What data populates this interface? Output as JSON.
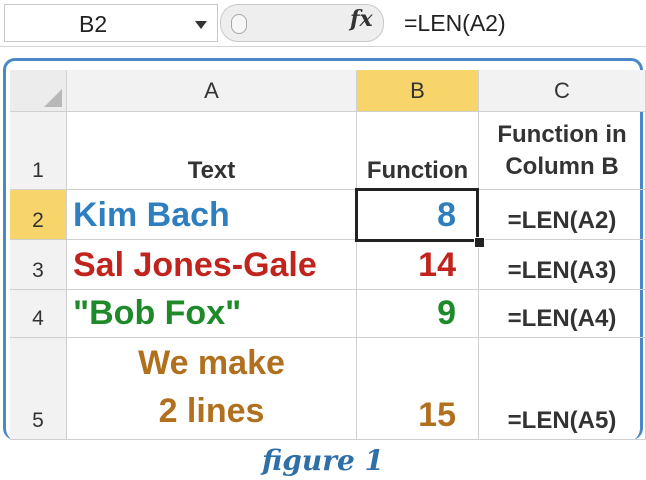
{
  "formula_bar": {
    "name_box": "B2",
    "fx_label": "fx",
    "formula": "=LEN(A2)"
  },
  "columns": [
    {
      "label": "A"
    },
    {
      "label": "B",
      "active": true
    },
    {
      "label": "C"
    }
  ],
  "rows": [
    {
      "num": "1",
      "a": "Text",
      "b": "Function",
      "c1": "Function in",
      "c2": "Column B"
    },
    {
      "num": "2",
      "a": "Kim Bach",
      "b": "8",
      "c": "=LEN(A2)",
      "color": "#2f7fbf"
    },
    {
      "num": "3",
      "a": "Sal Jones-Gale",
      "b": "14",
      "c": "=LEN(A3)",
      "color": "#c0241c"
    },
    {
      "num": "4",
      "a": "\"Bob Fox\"",
      "b": "9",
      "c": "=LEN(A4)",
      "color": "#1f8a2a"
    },
    {
      "num": "5",
      "a1": "We make",
      "a2": "2 lines",
      "b": "15",
      "c": "=LEN(A5)",
      "color": "#b0701e"
    }
  ],
  "selected_cell": "B2",
  "caption": "figure 1",
  "colors": {
    "accent_frame": "#4a88c8",
    "active_header": "#f8d56a",
    "caption": "#2f6fa8"
  }
}
